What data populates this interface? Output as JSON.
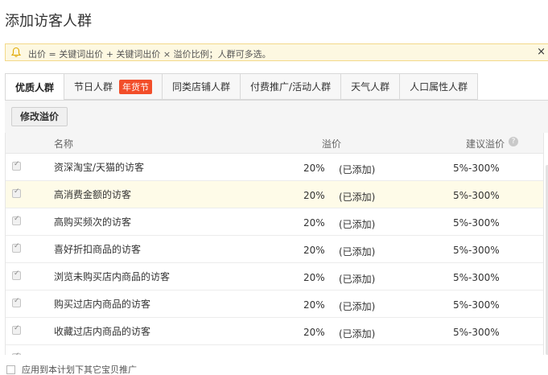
{
  "page": {
    "title": "添加访客人群"
  },
  "notice": {
    "text": "出价 = 关键词出价 + 关键词出价 × 溢价比例；人群可多选。",
    "close_label": "×"
  },
  "tabs": [
    {
      "label": "优质人群",
      "active": true
    },
    {
      "label": "节日人群",
      "badge": "年货节"
    },
    {
      "label": "同类店铺人群"
    },
    {
      "label": "付费推广/活动人群"
    },
    {
      "label": "天气人群"
    },
    {
      "label": "人口属性人群"
    }
  ],
  "toolbar": {
    "modify_label": "修改溢价"
  },
  "table": {
    "headers": {
      "name": "名称",
      "premium": "溢价",
      "suggest": "建议溢价",
      "help": "?"
    },
    "rows": [
      {
        "name": "资深淘宝/天猫的访客",
        "premium": "20%",
        "status": "(已添加)",
        "suggest": "5%-300%"
      },
      {
        "name": "高消费金额的访客",
        "premium": "20%",
        "status": "(已添加)",
        "suggest": "5%-300%"
      },
      {
        "name": "高购买频次的访客",
        "premium": "20%",
        "status": "(已添加)",
        "suggest": "5%-300%"
      },
      {
        "name": "喜好折扣商品的访客",
        "premium": "20%",
        "status": "(已添加)",
        "suggest": "5%-300%"
      },
      {
        "name": "浏览未购买店内商品的访客",
        "premium": "20%",
        "status": "(已添加)",
        "suggest": "5%-300%"
      },
      {
        "name": "购买过店内商品的访客",
        "premium": "20%",
        "status": "(已添加)",
        "suggest": "5%-300%"
      },
      {
        "name": "收藏过店内商品的访客",
        "premium": "20%",
        "status": "(已添加)",
        "suggest": "5%-300%"
      }
    ]
  },
  "footer": {
    "apply_label": "应用到本计划下其它宝贝推广"
  },
  "colors": {
    "badge": "#f24e2a",
    "notice_bg": "#fdf8e1",
    "row_highlight": "#fefbe8"
  }
}
